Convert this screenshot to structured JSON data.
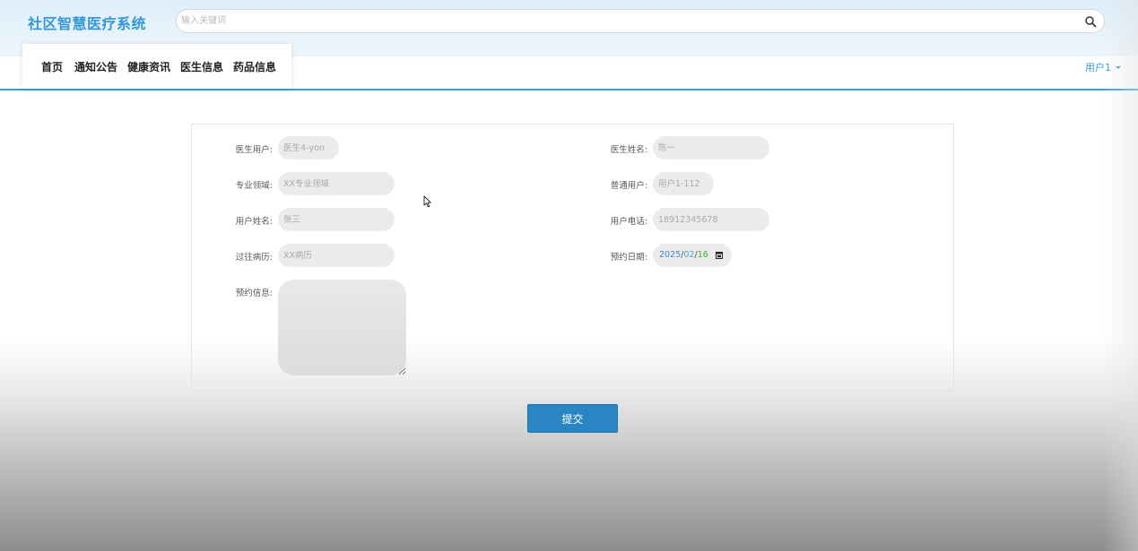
{
  "app": {
    "title": "社区智慧医疗系统"
  },
  "search": {
    "placeholder": "输入关键词",
    "value": "",
    "icon": "search-icon"
  },
  "nav": {
    "items": [
      {
        "label": "首页"
      },
      {
        "label": "通知公告"
      },
      {
        "label": "健康资讯"
      },
      {
        "label": "医生信息"
      },
      {
        "label": "药品信息"
      }
    ]
  },
  "user": {
    "label": "用户1"
  },
  "form": {
    "fields": [
      {
        "label": "医生用户:",
        "value": "医生4-yon"
      },
      {
        "label": "医生姓名:",
        "value": "陈一"
      },
      {
        "label": "专业领域:",
        "value": "XX专业领域"
      },
      {
        "label": "普通用户:",
        "value": "用户1-112"
      },
      {
        "label": "用户姓名:",
        "value": "张三"
      },
      {
        "label": "用户电话:",
        "value": "18912345678"
      },
      {
        "label": "过往病历:",
        "value": "XX病历"
      },
      {
        "label": "预约日期:",
        "year": "2025",
        "month": "02",
        "day": "16",
        "sep": "/"
      },
      {
        "label": "预约信息:",
        "value": ""
      }
    ],
    "submit_label": "提交"
  },
  "colors": {
    "brand": "#3597d6",
    "accent_line": "#3a9bd6",
    "submit_bg": "#2a86c3",
    "input_bg": "#ebebeb"
  }
}
